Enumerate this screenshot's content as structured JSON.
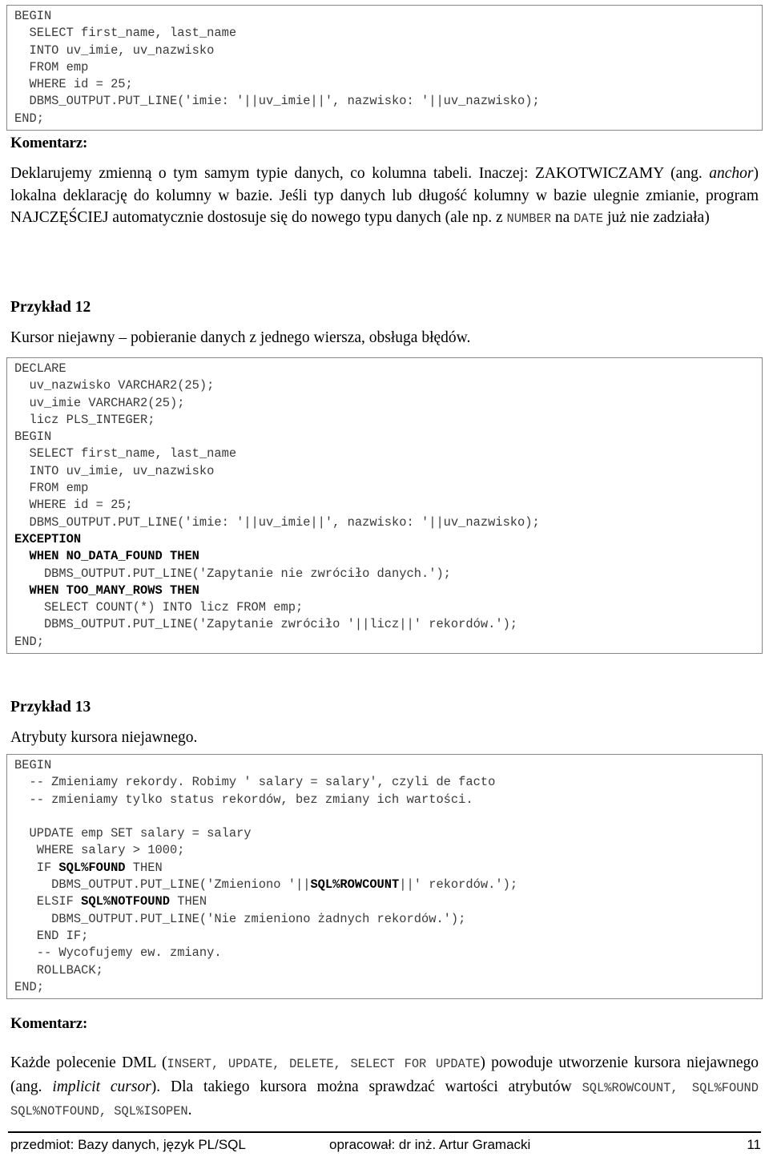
{
  "document": {
    "language": "pl",
    "page_number": "11"
  },
  "blocks": {
    "code1": "BEGIN\n  SELECT first_name, last_name\n  INTO uv_imie, uv_nazwisko\n  FROM emp\n  WHERE id = 25;\n  DBMS_OUTPUT.PUT_LINE('imie: '||uv_imie||', nazwisko: '||uv_nazwisko);\nEND;",
    "code2_pre": "DECLARE\n  uv_nazwisko VARCHAR2(25);\n  uv_imie VARCHAR2(25);\n  licz PLS_INTEGER;\nBEGIN\n  SELECT first_name, last_name\n  INTO uv_imie, uv_nazwisko\n  FROM emp\n  WHERE id = 25;\n  DBMS_OUTPUT.PUT_LINE('imie: '||uv_imie||', nazwisko: '||uv_nazwisko);\n",
    "code2_b1": "EXCEPTION",
    "code2_mid1": "\n  ",
    "code2_b2": "WHEN NO_DATA_FOUND THEN",
    "code2_mid2": "\n    DBMS_OUTPUT.PUT_LINE('Zapytanie nie zwróciło danych.');\n  ",
    "code2_b3": "WHEN TOO_MANY_ROWS THEN",
    "code2_post": "\n    SELECT COUNT(*) INTO licz FROM emp;\n    DBMS_OUTPUT.PUT_LINE('Zapytanie zwróciło '||licz||' rekordów.');\nEND;",
    "code3_pre": "BEGIN\n  -- Zmieniamy rekordy. Robimy ' salary = salary', czyli de facto\n  -- zmieniamy tylko status rekordów, bez zmiany ich wartości.\n\n  UPDATE emp SET salary = salary\n   WHERE salary > 1000;\n   IF ",
    "code3_b1": "SQL%FOUND",
    "code3_mid1": " THEN\n     DBMS_OUTPUT.PUT_LINE('Zmieniono '||",
    "code3_b2": "SQL%ROWCOUNT",
    "code3_mid2": "||' rekordów.');\n   ELSIF ",
    "code3_b3": "SQL%NOTFOUND",
    "code3_post": " THEN\n     DBMS_OUTPUT.PUT_LINE('Nie zmieniono żadnych rekordów.');\n   END IF;\n   -- Wycofujemy ew. zmiany.\n   ROLLBACK;\nEND;"
  },
  "headings": {
    "komentarz_1": "Komentarz:",
    "komentarz_2": "Komentarz:",
    "przyklad_12": "Przykład 12",
    "przyklad_13": "Przykład 13"
  },
  "paragraphs": {
    "komentarz_1_p1": "Deklarujemy zmienną o tym samym typie danych, co kolumna tabeli. Inaczej: ZAKOTWICZAMY (ang. ",
    "komentarz_1_p1_i": "anchor",
    "komentarz_1_p2": ") lokalna deklarację do kolumny w bazie. Jeśli typ danych lub długość kolumny w bazie ulegnie zmianie, program NAJCZĘŚCIEJ automatycznie dostosuje się do nowego typu danych  (ale np. z ",
    "komentarz_1_m1": "NUMBER",
    "komentarz_1_p3": " na ",
    "komentarz_1_m2": "DATE",
    "komentarz_1_p4": " już nie zadziała)",
    "przyklad_12_sub": "Kursor niejawny – pobieranie danych z jednego wiersza, obsługa błędów.",
    "przyklad_13_sub": "Atrybuty kursora niejawnego.",
    "komentarz_2_p1": "Każde polecenie DML (",
    "komentarz_2_m1": "INSERT, UPDATE, DELETE, SELECT FOR UPDATE",
    "komentarz_2_p2": ") powoduje utworzenie kursora niejawnego (ang. ",
    "komentarz_2_p2_i": "implicit cursor",
    "komentarz_2_p3": "). Dla takiego kursora można sprawdzać wartości atrybutów ",
    "komentarz_2_m2": "SQL%ROWCOUNT, SQL%FOUND SQL%NOTFOUND, SQL%ISOPEN",
    "komentarz_2_p4": "."
  },
  "footer": {
    "subject": "przedmiot: Bazy danych, język PL/SQL",
    "author": "opracował: dr inż. Artur Gramacki",
    "page": "11"
  },
  "colors": {
    "code_text": "#3a3a3a",
    "code_border": "#868686",
    "body_text": "#000000",
    "background": "#ffffff"
  }
}
